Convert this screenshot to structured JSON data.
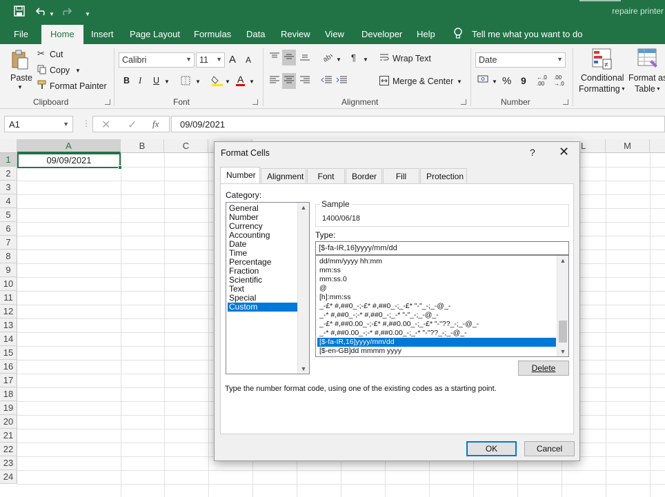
{
  "window": {
    "title": "repaire printer",
    "accent_color": "#217346"
  },
  "quick_access": {
    "save_icon": "save-icon",
    "undo_icon": "undo-icon",
    "redo_icon": "redo-icon",
    "customize_icon": "customize-toolbar-icon"
  },
  "ribbon_tabs": [
    "File",
    "Home",
    "Insert",
    "Page Layout",
    "Formulas",
    "Data",
    "Review",
    "View",
    "Developer",
    "Help"
  ],
  "tell_me": "Tell me what you want to do",
  "clipboard": {
    "paste": "Paste",
    "cut": "Cut",
    "copy": "Copy",
    "format_painter": "Format Painter",
    "label": "Clipboard"
  },
  "font_group": {
    "font_name": "Calibri",
    "font_size": "11",
    "bold": "B",
    "italic": "I",
    "underline": "U",
    "grow": "A",
    "shrink": "A",
    "font_color_letter": "A",
    "label": "Font"
  },
  "alignment_group": {
    "wrap_text": "Wrap Text",
    "merge_center": "Merge & Center",
    "label": "Alignment"
  },
  "number_group": {
    "format": "Date",
    "percent": "%",
    "comma": "9",
    "inc_decimal": "←.0 .00",
    "dec_decimal": ".00 →.0",
    "label": "Number"
  },
  "styles_group": {
    "conditional_line1": "Conditional",
    "conditional_line2": "Formatting",
    "format_as_line1": "Format as",
    "format_as_line2": "Table"
  },
  "formula_bar": {
    "name_box": "A1",
    "fx": "fx",
    "value": "09/09/2021"
  },
  "grid": {
    "columns": [
      "A",
      "B",
      "C",
      "L",
      "M"
    ],
    "rows": [
      "1",
      "2",
      "3",
      "4",
      "5",
      "6",
      "7",
      "8",
      "9",
      "10",
      "11",
      "12",
      "13",
      "14",
      "15",
      "16",
      "17",
      "18",
      "19",
      "20",
      "21",
      "22",
      "23",
      "24"
    ],
    "a1_value": "09/09/2021"
  },
  "dialog": {
    "title": "Format Cells",
    "help": "?",
    "tabs": [
      "Number",
      "Alignment",
      "Font",
      "Border",
      "Fill",
      "Protection"
    ],
    "category_label": "Category:",
    "categories": [
      "General",
      "Number",
      "Currency",
      "Accounting",
      "Date",
      "Time",
      "Percentage",
      "Fraction",
      "Scientific",
      "Text",
      "Special",
      "Custom"
    ],
    "selected_category": "Custom",
    "sample_label": "Sample",
    "sample_value": "1400/06/18",
    "type_label": "Type:",
    "type_value": "[$-fa-IR,16]yyyy/mm/dd",
    "type_list": [
      "dd/mm/yyyy hh:mm",
      "mm:ss",
      "mm:ss.0",
      "@",
      "[h]:mm:ss",
      "_-£* #,##0_-;-£* #,##0_-;_-£* \"-\"_-;_-@_-",
      "_-* #,##0_-;-* #,##0_-;_-* \"-\"_-;_-@_-",
      "_-£* #,##0.00_-;-£* #,##0.00_-;_-£* \"-\"??_-;_-@_-",
      "_-* #,##0.00_-;-* #,##0.00_-;_-* \"-\"??_-;_-@_-",
      "[$-fa-IR,16]yyyy/mm/dd",
      "[$-en-GB]dd mmmm yyyy"
    ],
    "selected_type_index": 9,
    "delete_button": "Delete",
    "hint": "Type the number format code, using one of the existing codes as a starting point.",
    "ok_button": "OK",
    "cancel_button": "Cancel"
  }
}
